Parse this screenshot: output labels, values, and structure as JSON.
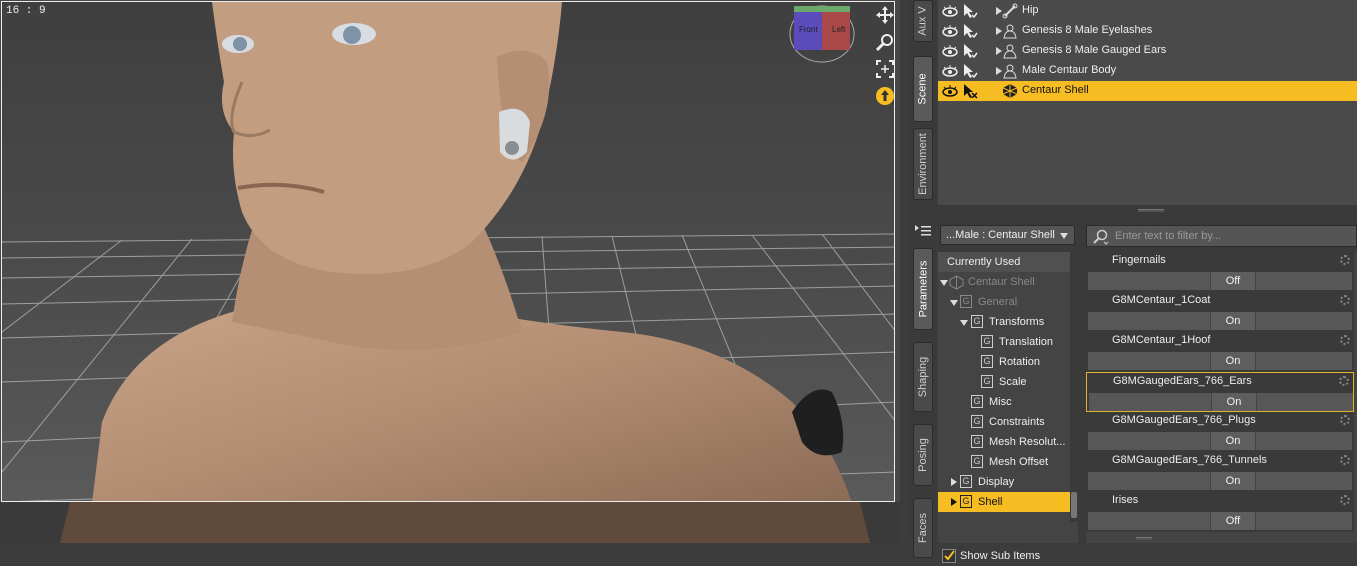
{
  "viewport": {
    "aspect_label": "16 : 9",
    "tools": [
      "move-tool-icon",
      "zoom-tool-icon",
      "frame-tool-icon",
      "orbit-tool-icon"
    ],
    "view_cube": {
      "front_label": "Front",
      "right_label": "Left"
    }
  },
  "side_tabs_top": [
    "Aux V",
    "Scene",
    "Environment"
  ],
  "side_tabs_bottom": [
    "Parameters",
    "Shaping",
    "Posing",
    "Faces"
  ],
  "scene": {
    "rows": [
      {
        "label": "Hip",
        "icon": "bone-icon",
        "selected": false
      },
      {
        "label": "Genesis 8 Male Eyelashes",
        "icon": "figure-icon",
        "selected": false
      },
      {
        "label": "Genesis 8 Male Gauged Ears",
        "icon": "figure-icon",
        "selected": false
      },
      {
        "label": "Male Centaur Body",
        "icon": "figure-icon",
        "selected": false
      },
      {
        "label": "Centaur Shell",
        "icon": "shell-icon",
        "selected": true
      }
    ]
  },
  "parameters": {
    "node_select": "...Male : Centaur Shell",
    "filter_placeholder": "Enter text to filter by...",
    "tree": {
      "currently_used": "Currently Used",
      "centaur_shell": "Centaur Shell",
      "general": "General",
      "transforms": "Transforms",
      "translation": "Translation",
      "rotation": "Rotation",
      "scale": "Scale",
      "misc": "Misc",
      "constraints": "Constraints",
      "mesh_resolution": "Mesh Resolut...",
      "mesh_offset": "Mesh Offset",
      "display": "Display",
      "shell": "Shell",
      "show_sub_items": "Show Sub Items",
      "group_glyph": "G"
    },
    "properties": [
      {
        "name": "Fingernails",
        "value": "Off",
        "highlight": false
      },
      {
        "name": "G8MCentaur_1Coat",
        "value": "On",
        "highlight": false
      },
      {
        "name": "G8MCentaur_1Hoof",
        "value": "On",
        "highlight": false
      },
      {
        "name": "G8MGaugedEars_766_Ears",
        "value": "On",
        "highlight": true
      },
      {
        "name": "G8MGaugedEars_766_Plugs",
        "value": "On",
        "highlight": false
      },
      {
        "name": "G8MGaugedEars_766_Tunnels",
        "value": "On",
        "highlight": false
      },
      {
        "name": "Irises",
        "value": "Off",
        "highlight": false
      }
    ]
  },
  "colors": {
    "accent": "#f5bd21",
    "panel": "#3a3a3a"
  }
}
